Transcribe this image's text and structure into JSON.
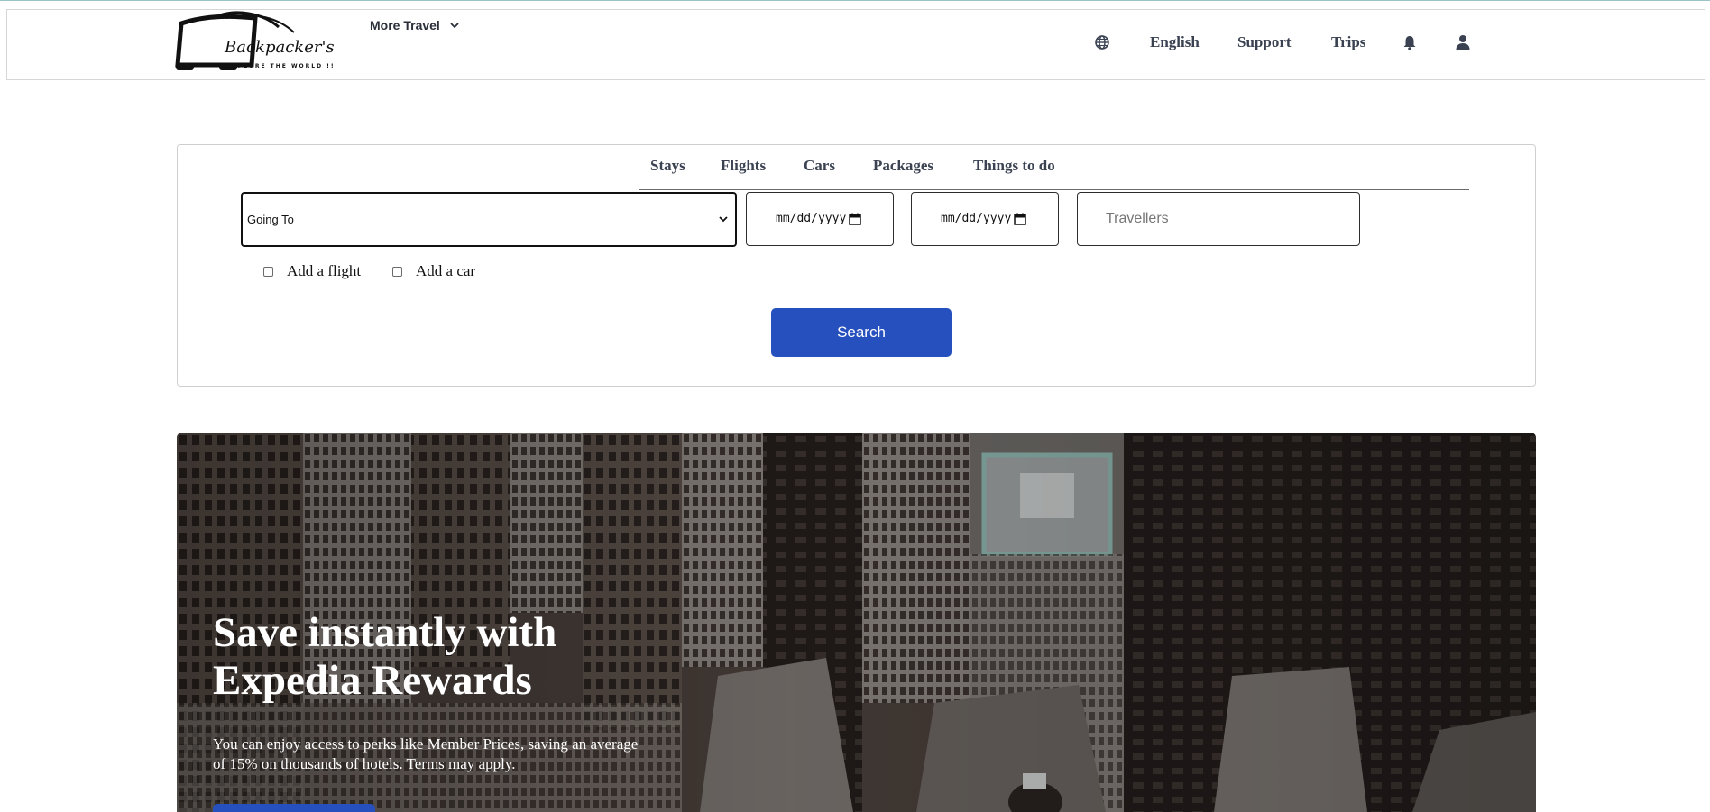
{
  "header": {
    "logo": {
      "name": "Backpacker's",
      "tagline": "EXPLORE THE WORLD !!"
    },
    "more_travel": "More Travel",
    "language": "English",
    "support": "Support",
    "trips": "Trips",
    "icons": [
      "globe-icon",
      "bell-icon",
      "user-icon"
    ]
  },
  "search": {
    "tabs": [
      "Stays",
      "Flights",
      "Cars",
      "Packages",
      "Things to do"
    ],
    "destination_selected": "Going To",
    "date_placeholder_1": "mm/dd/yyyy",
    "date_placeholder_2": "mm/dd/yyyy",
    "travellers_placeholder": "Travellers",
    "add_flight": "Add a flight",
    "add_car": "Add a car",
    "search_button": "Search",
    "accent": "#2650bd"
  },
  "hero": {
    "title_line1": "Save instantly with",
    "title_line2": "Expedia Rewards",
    "text_line1": "You can enjoy access to perks like Member Prices, saving an average",
    "text_line2": "of 15% on thousands of hotels. Terms may apply."
  }
}
